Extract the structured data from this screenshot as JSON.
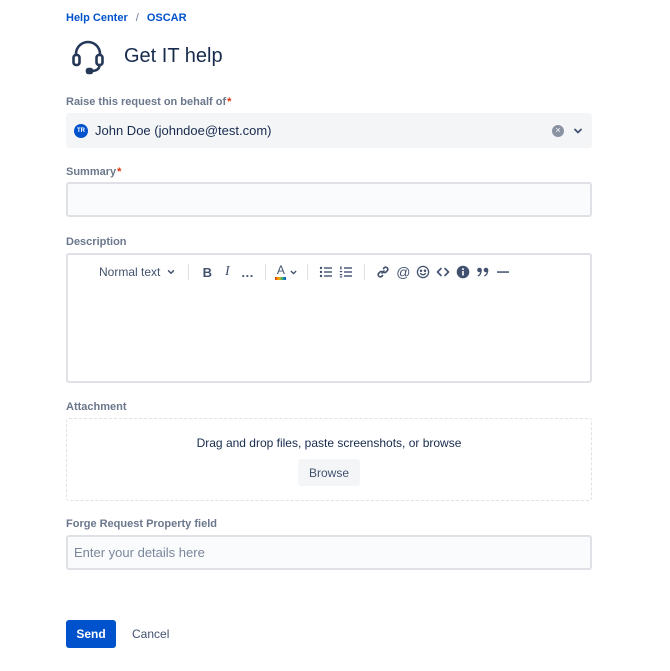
{
  "breadcrumb": {
    "home": "Help Center",
    "separator": "/",
    "project": "OSCAR"
  },
  "header": {
    "title": "Get IT help",
    "icon": "headset-icon"
  },
  "on_behalf": {
    "label": "Raise this request on behalf of",
    "required_mark": "*",
    "avatar_initials": "TR",
    "value": "John Doe (johndoe@test.com)"
  },
  "summary": {
    "label": "Summary",
    "required_mark": "*",
    "value": "",
    "placeholder": ""
  },
  "description": {
    "label": "Description",
    "toolbar": {
      "text_style": "Normal text",
      "bold": "B",
      "italic": "I",
      "more": "…",
      "text_color": "A"
    }
  },
  "attachment": {
    "label": "Attachment",
    "hint": "Drag and drop files, paste screenshots, or browse",
    "browse_label": "Browse"
  },
  "forge": {
    "label": "Forge Request Property field",
    "value": "",
    "placeholder": "Enter your details here"
  },
  "actions": {
    "send_label": "Send",
    "cancel_label": "Cancel"
  },
  "colors": {
    "accent": "#0052cc",
    "required": "#de350b",
    "muted_label": "#6b778c"
  }
}
